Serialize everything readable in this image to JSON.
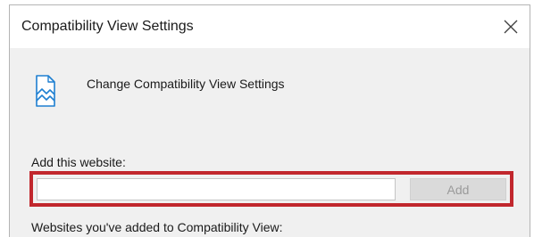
{
  "window": {
    "title": "Compatibility View Settings",
    "close_icon": "close-icon"
  },
  "header": {
    "icon": "compatibility-view-icon",
    "text": "Change Compatibility View Settings"
  },
  "add_section": {
    "label": "Add this website:",
    "input_value": "",
    "input_placeholder": "",
    "add_button_label": "Add",
    "add_button_enabled": false,
    "highlight_color": "#c1272d"
  },
  "added_section": {
    "label": "Websites you've added to Compatibility View:"
  },
  "colors": {
    "dialog_background": "#f0f0f0",
    "title_bar_background": "#ffffff",
    "icon_accent": "#1e7fd1"
  }
}
